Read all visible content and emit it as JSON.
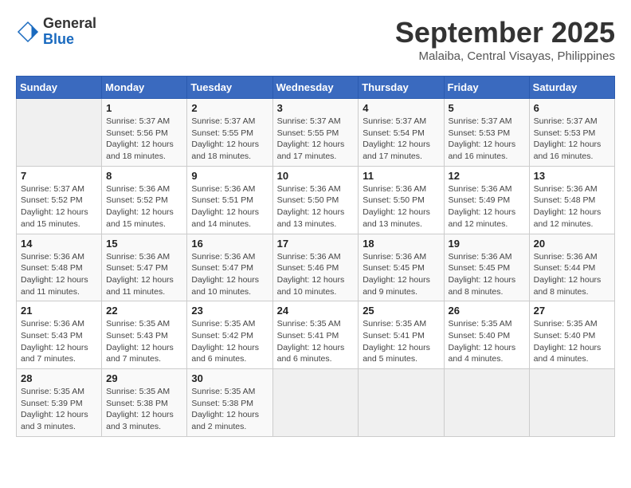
{
  "logo": {
    "general": "General",
    "blue": "Blue"
  },
  "header": {
    "month": "September 2025",
    "location": "Malaiba, Central Visayas, Philippines"
  },
  "weekdays": [
    "Sunday",
    "Monday",
    "Tuesday",
    "Wednesday",
    "Thursday",
    "Friday",
    "Saturday"
  ],
  "weeks": [
    [
      {
        "day": "",
        "info": ""
      },
      {
        "day": "1",
        "info": "Sunrise: 5:37 AM\nSunset: 5:56 PM\nDaylight: 12 hours\nand 18 minutes."
      },
      {
        "day": "2",
        "info": "Sunrise: 5:37 AM\nSunset: 5:55 PM\nDaylight: 12 hours\nand 18 minutes."
      },
      {
        "day": "3",
        "info": "Sunrise: 5:37 AM\nSunset: 5:55 PM\nDaylight: 12 hours\nand 17 minutes."
      },
      {
        "day": "4",
        "info": "Sunrise: 5:37 AM\nSunset: 5:54 PM\nDaylight: 12 hours\nand 17 minutes."
      },
      {
        "day": "5",
        "info": "Sunrise: 5:37 AM\nSunset: 5:53 PM\nDaylight: 12 hours\nand 16 minutes."
      },
      {
        "day": "6",
        "info": "Sunrise: 5:37 AM\nSunset: 5:53 PM\nDaylight: 12 hours\nand 16 minutes."
      }
    ],
    [
      {
        "day": "7",
        "info": "Sunrise: 5:37 AM\nSunset: 5:52 PM\nDaylight: 12 hours\nand 15 minutes."
      },
      {
        "day": "8",
        "info": "Sunrise: 5:36 AM\nSunset: 5:52 PM\nDaylight: 12 hours\nand 15 minutes."
      },
      {
        "day": "9",
        "info": "Sunrise: 5:36 AM\nSunset: 5:51 PM\nDaylight: 12 hours\nand 14 minutes."
      },
      {
        "day": "10",
        "info": "Sunrise: 5:36 AM\nSunset: 5:50 PM\nDaylight: 12 hours\nand 13 minutes."
      },
      {
        "day": "11",
        "info": "Sunrise: 5:36 AM\nSunset: 5:50 PM\nDaylight: 12 hours\nand 13 minutes."
      },
      {
        "day": "12",
        "info": "Sunrise: 5:36 AM\nSunset: 5:49 PM\nDaylight: 12 hours\nand 12 minutes."
      },
      {
        "day": "13",
        "info": "Sunrise: 5:36 AM\nSunset: 5:48 PM\nDaylight: 12 hours\nand 12 minutes."
      }
    ],
    [
      {
        "day": "14",
        "info": "Sunrise: 5:36 AM\nSunset: 5:48 PM\nDaylight: 12 hours\nand 11 minutes."
      },
      {
        "day": "15",
        "info": "Sunrise: 5:36 AM\nSunset: 5:47 PM\nDaylight: 12 hours\nand 11 minutes."
      },
      {
        "day": "16",
        "info": "Sunrise: 5:36 AM\nSunset: 5:47 PM\nDaylight: 12 hours\nand 10 minutes."
      },
      {
        "day": "17",
        "info": "Sunrise: 5:36 AM\nSunset: 5:46 PM\nDaylight: 12 hours\nand 10 minutes."
      },
      {
        "day": "18",
        "info": "Sunrise: 5:36 AM\nSunset: 5:45 PM\nDaylight: 12 hours\nand 9 minutes."
      },
      {
        "day": "19",
        "info": "Sunrise: 5:36 AM\nSunset: 5:45 PM\nDaylight: 12 hours\nand 8 minutes."
      },
      {
        "day": "20",
        "info": "Sunrise: 5:36 AM\nSunset: 5:44 PM\nDaylight: 12 hours\nand 8 minutes."
      }
    ],
    [
      {
        "day": "21",
        "info": "Sunrise: 5:36 AM\nSunset: 5:43 PM\nDaylight: 12 hours\nand 7 minutes."
      },
      {
        "day": "22",
        "info": "Sunrise: 5:35 AM\nSunset: 5:43 PM\nDaylight: 12 hours\nand 7 minutes."
      },
      {
        "day": "23",
        "info": "Sunrise: 5:35 AM\nSunset: 5:42 PM\nDaylight: 12 hours\nand 6 minutes."
      },
      {
        "day": "24",
        "info": "Sunrise: 5:35 AM\nSunset: 5:41 PM\nDaylight: 12 hours\nand 6 minutes."
      },
      {
        "day": "25",
        "info": "Sunrise: 5:35 AM\nSunset: 5:41 PM\nDaylight: 12 hours\nand 5 minutes."
      },
      {
        "day": "26",
        "info": "Sunrise: 5:35 AM\nSunset: 5:40 PM\nDaylight: 12 hours\nand 4 minutes."
      },
      {
        "day": "27",
        "info": "Sunrise: 5:35 AM\nSunset: 5:40 PM\nDaylight: 12 hours\nand 4 minutes."
      }
    ],
    [
      {
        "day": "28",
        "info": "Sunrise: 5:35 AM\nSunset: 5:39 PM\nDaylight: 12 hours\nand 3 minutes."
      },
      {
        "day": "29",
        "info": "Sunrise: 5:35 AM\nSunset: 5:38 PM\nDaylight: 12 hours\nand 3 minutes."
      },
      {
        "day": "30",
        "info": "Sunrise: 5:35 AM\nSunset: 5:38 PM\nDaylight: 12 hours\nand 2 minutes."
      },
      {
        "day": "",
        "info": ""
      },
      {
        "day": "",
        "info": ""
      },
      {
        "day": "",
        "info": ""
      },
      {
        "day": "",
        "info": ""
      }
    ]
  ]
}
